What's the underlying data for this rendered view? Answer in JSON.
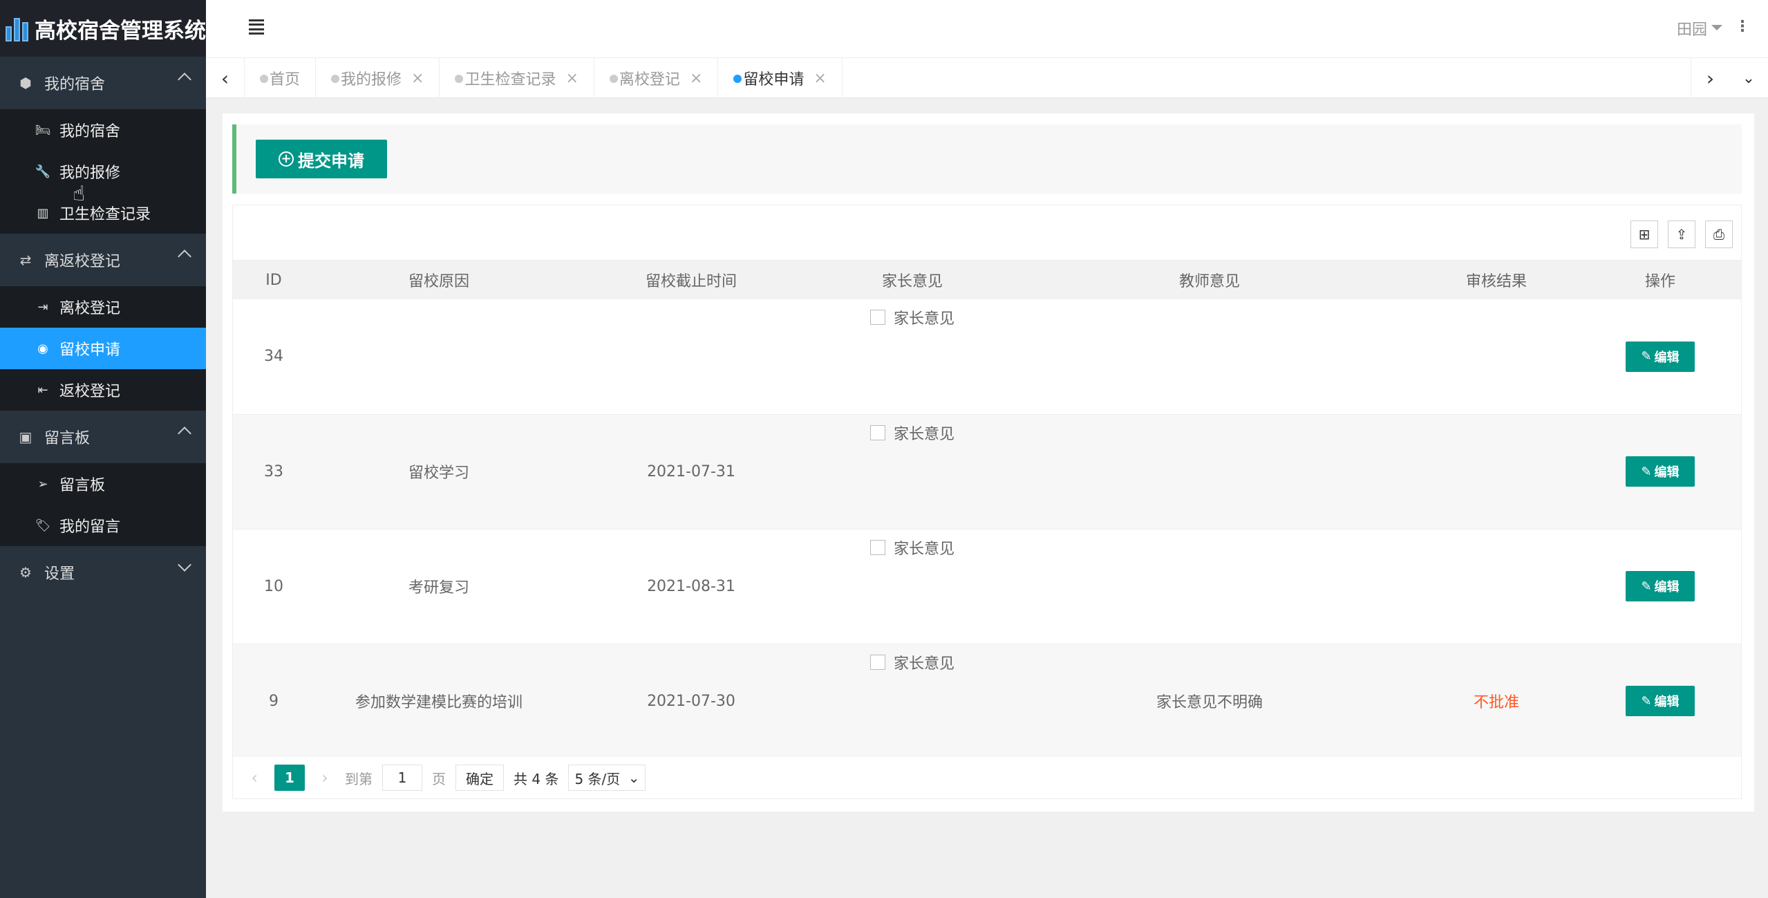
{
  "app": {
    "title": "高校宿舍管理系统"
  },
  "sidebar": {
    "groups": [
      {
        "label": "我的宿舍",
        "items": [
          {
            "label": "我的宿舍"
          },
          {
            "label": "我的报修"
          },
          {
            "label": "卫生检查记录"
          }
        ]
      },
      {
        "label": "离返校登记",
        "items": [
          {
            "label": "离校登记"
          },
          {
            "label": "留校申请"
          },
          {
            "label": "返校登记"
          }
        ]
      },
      {
        "label": "留言板",
        "items": [
          {
            "label": "留言板"
          },
          {
            "label": "我的留言"
          }
        ]
      },
      {
        "label": "设置",
        "items": []
      }
    ],
    "active_item": "留校申请"
  },
  "header": {
    "user": "田园"
  },
  "tabs": [
    {
      "label": "首页"
    },
    {
      "label": "我的报修"
    },
    {
      "label": "卫生检查记录"
    },
    {
      "label": "离校登记"
    },
    {
      "label": "留校申请"
    }
  ],
  "toolbar": {
    "submit_label": "提交申请"
  },
  "table": {
    "columns": [
      "ID",
      "留校原因",
      "留校截止时间",
      "家长意见",
      "教师意见",
      "审核结果",
      "操作"
    ],
    "rows": [
      {
        "id": "34",
        "reason": "",
        "deadline": "",
        "parent": "家长意见",
        "teacher": "",
        "result": "",
        "action": "编辑"
      },
      {
        "id": "33",
        "reason": "留校学习",
        "deadline": "2021-07-31",
        "parent": "家长意见",
        "teacher": "",
        "result": "",
        "action": "编辑"
      },
      {
        "id": "10",
        "reason": "考研复习",
        "deadline": "2021-08-31",
        "parent": "家长意见",
        "teacher": "",
        "result": "",
        "action": "编辑"
      },
      {
        "id": "9",
        "reason": "参加数学建模比赛的培训",
        "deadline": "2021-07-30",
        "parent": "家长意见",
        "teacher": "家长意见不明确",
        "result": "不批准",
        "action": "编辑"
      }
    ]
  },
  "pager": {
    "current": "1",
    "goto_label": "到第",
    "goto_value": "1",
    "page_label": "页",
    "confirm_label": "确定",
    "total_label": "共 4 条",
    "page_size": "5 条/页"
  },
  "colors": {
    "accent": "#009688",
    "active_nav": "#1e9fff",
    "danger": "#ff5722"
  }
}
